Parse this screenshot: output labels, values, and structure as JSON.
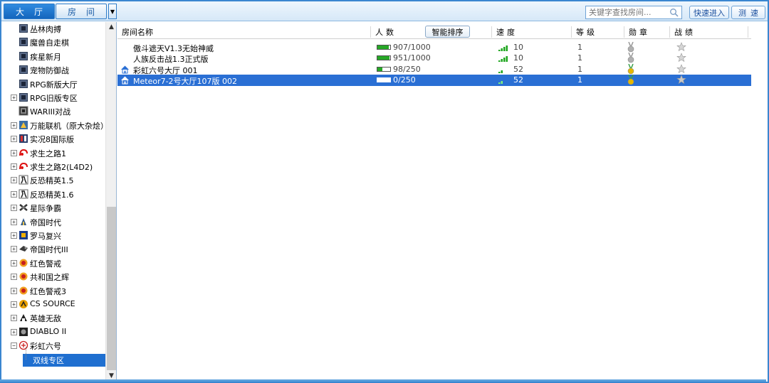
{
  "tabs": [
    {
      "label": "大厅",
      "active": true
    },
    {
      "label": "房间",
      "active": false
    }
  ],
  "search": {
    "placeholder": "关键字查找房间..."
  },
  "buttons": {
    "quick_enter": "快速进入",
    "test_speed": "测速"
  },
  "tree": [
    {
      "label": "丛林肉搏",
      "icon": "war3-icon",
      "expandable": false,
      "indent": 1
    },
    {
      "label": "魔兽自走棋",
      "icon": "war3-icon",
      "expandable": false,
      "indent": 1
    },
    {
      "label": "疾星新月",
      "icon": "war3-icon",
      "expandable": false,
      "indent": 1
    },
    {
      "label": "宠物防御战",
      "icon": "war3-icon",
      "expandable": false,
      "indent": 1
    },
    {
      "label": "RPG新版大厅",
      "icon": "war3-icon",
      "expandable": false,
      "indent": 1
    },
    {
      "label": "RPG旧版专区",
      "icon": "war3-icon",
      "expandable": true,
      "indent": 0
    },
    {
      "label": "WARIII对战",
      "icon": "war3-battle-icon",
      "expandable": false,
      "indent": 0
    },
    {
      "label": "万能联机（原大杂烩）",
      "icon": "universal-icon",
      "expandable": true,
      "indent": 0
    },
    {
      "label": "实况8国际版",
      "icon": "soccer-icon",
      "expandable": true,
      "indent": 0
    },
    {
      "label": "求生之路1",
      "icon": "l4d-icon",
      "expandable": true,
      "indent": 0
    },
    {
      "label": "求生之路2(L4D2)",
      "icon": "l4d-icon",
      "expandable": true,
      "indent": 0
    },
    {
      "label": "反恐精英1.5",
      "icon": "cs-icon",
      "expandable": true,
      "indent": 0
    },
    {
      "label": "反恐精英1.6",
      "icon": "cs-icon",
      "expandable": true,
      "indent": 0
    },
    {
      "label": "星际争霸",
      "icon": "starcraft-icon",
      "expandable": true,
      "indent": 0
    },
    {
      "label": "帝国时代",
      "icon": "aoe-icon",
      "expandable": true,
      "indent": 0
    },
    {
      "label": "罗马复兴",
      "icon": "rome-icon",
      "expandable": true,
      "indent": 0
    },
    {
      "label": "帝国时代III",
      "icon": "aoe3-icon",
      "expandable": true,
      "indent": 0
    },
    {
      "label": "红色警戒",
      "icon": "redalert-icon",
      "expandable": true,
      "indent": 0
    },
    {
      "label": "共和国之辉",
      "icon": "redalert-icon",
      "expandable": true,
      "indent": 0
    },
    {
      "label": "红色警戒3",
      "icon": "redalert-icon",
      "expandable": true,
      "indent": 0
    },
    {
      "label": "CS SOURCE",
      "icon": "css-icon",
      "expandable": true,
      "indent": 0
    },
    {
      "label": "英雄无敌",
      "icon": "heroes-icon",
      "expandable": true,
      "indent": 0
    },
    {
      "label": "DIABLO II",
      "icon": "diablo-icon",
      "expandable": true,
      "indent": 0
    },
    {
      "label": "彩虹六号",
      "icon": "r6-icon",
      "expandable": true,
      "expanded": true,
      "indent": 0
    },
    {
      "label": "双线专区",
      "icon": "",
      "expandable": false,
      "indent": 2,
      "selected": true
    }
  ],
  "table": {
    "headers": {
      "name": "房间名称",
      "people": "人数",
      "sort_button": "智能排序",
      "speed": "速度",
      "level": "等级",
      "medal": "勋章",
      "record": "战绩"
    },
    "rows": [
      {
        "name": "傲斗遮天V1.3无始神威",
        "home": false,
        "people": "907/1000",
        "fill": 0.907,
        "speed": "10",
        "signal": 4,
        "level": "1",
        "medal": "silver",
        "selected": false
      },
      {
        "name": "人族反击战1.3正式版",
        "home": false,
        "people": "951/1000",
        "fill": 0.951,
        "speed": "10",
        "signal": 4,
        "level": "1",
        "medal": "silver",
        "selected": false
      },
      {
        "name": "彩虹六号大厅 001",
        "home": true,
        "people": "98/250",
        "fill": 0.392,
        "speed": "52",
        "signal": 2,
        "level": "1",
        "medal": "gold",
        "selected": false
      },
      {
        "name": "Meteor7-2号大厅107版 002",
        "home": true,
        "people": "0/250",
        "fill": 0.0,
        "speed": "52",
        "signal": 2,
        "level": "1",
        "medal": "gold",
        "selected": true
      }
    ]
  },
  "colors": {
    "accent": "#1f6fd0",
    "selected_row": "#2a6fd4",
    "frame": "#3a86d0"
  }
}
